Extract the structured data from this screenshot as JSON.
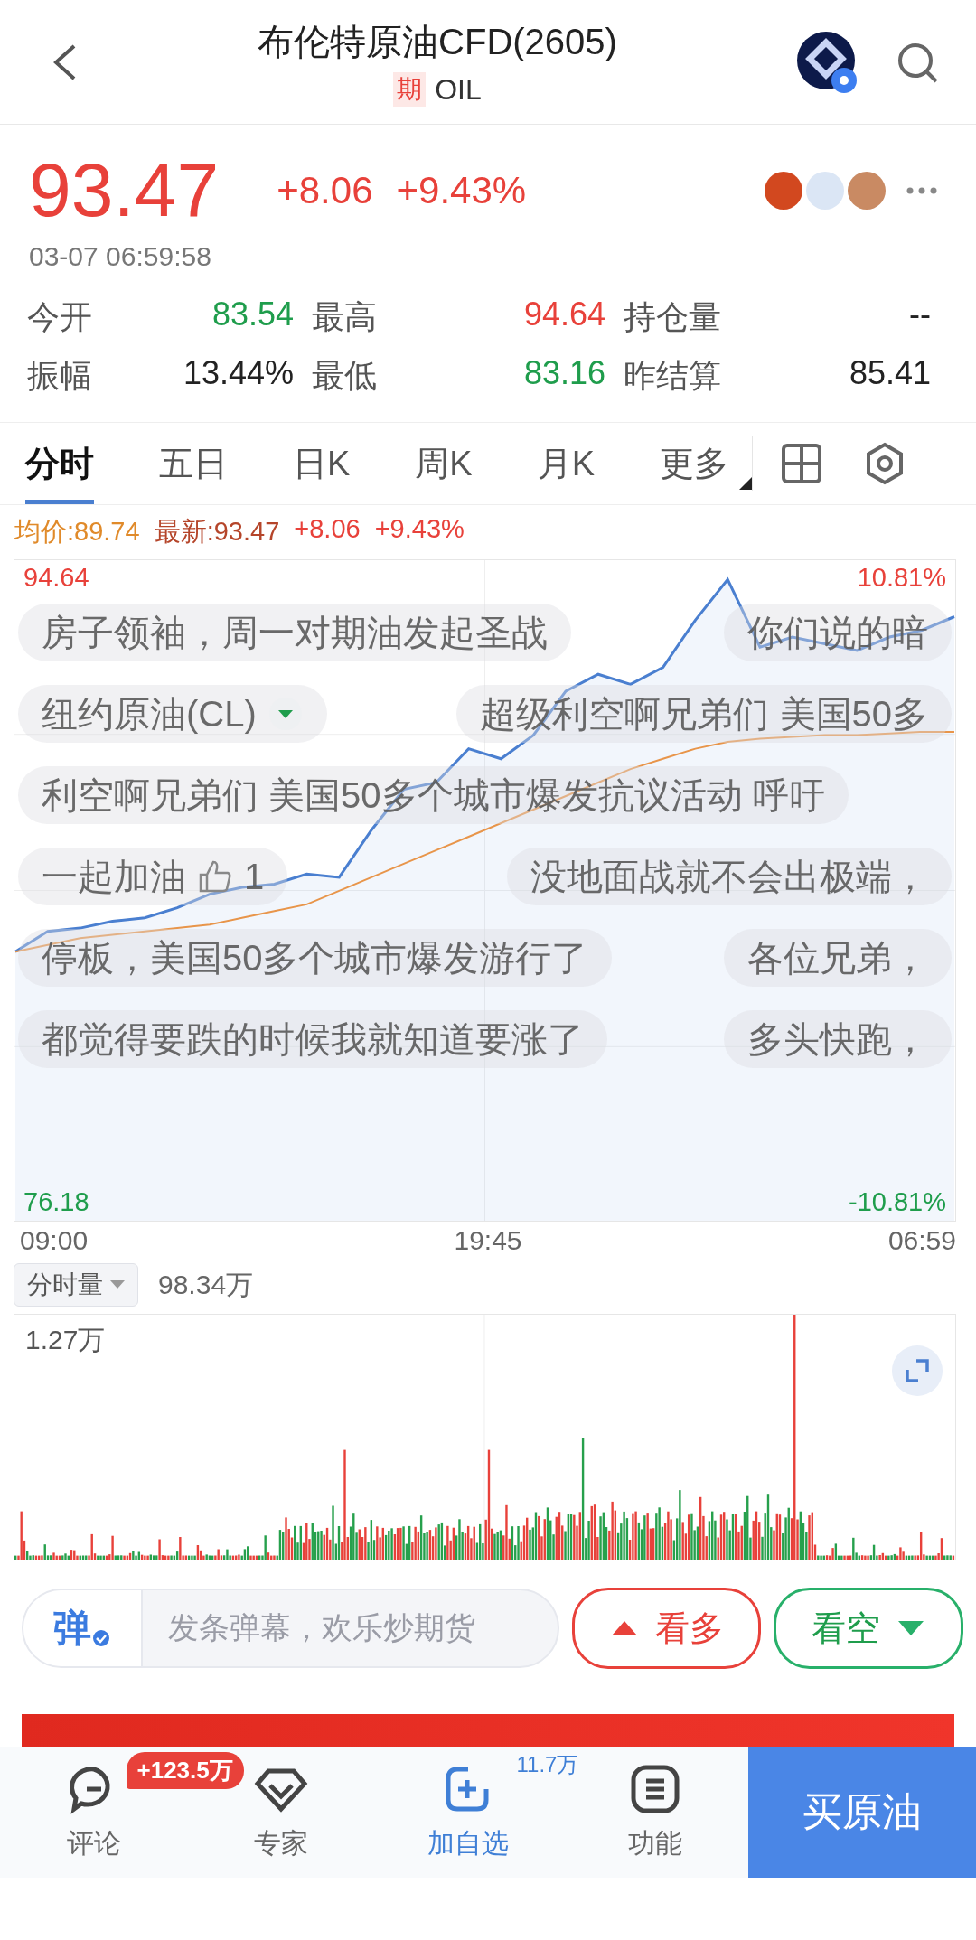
{
  "header": {
    "title": "布伦特原油CFD(2605)",
    "badge": "期",
    "code": "OIL"
  },
  "quote": {
    "price": "93.47",
    "change": "+8.06",
    "change_pct": "+9.43%",
    "time": "03-07 06:59:58"
  },
  "stats": [
    {
      "label": "今开",
      "value": "83.54",
      "color": "#1f9d4c"
    },
    {
      "label": "最高",
      "value": "94.64",
      "color": "#e8413a"
    },
    {
      "label": "持仓量",
      "value": "--",
      "color": "#222222"
    },
    {
      "label": "振幅",
      "value": "13.44%",
      "color": "#222222"
    },
    {
      "label": "最低",
      "value": "83.16",
      "color": "#1f9d4c"
    },
    {
      "label": "昨结算",
      "value": "85.41",
      "color": "#222222"
    }
  ],
  "tabs": [
    {
      "label": "分时",
      "selected": true,
      "kind": "period"
    },
    {
      "label": "五日",
      "selected": false,
      "kind": "period"
    },
    {
      "label": "日K",
      "selected": false,
      "kind": "period"
    },
    {
      "label": "周K",
      "selected": false,
      "kind": "period"
    },
    {
      "label": "月K",
      "selected": false,
      "kind": "period"
    },
    {
      "label": "更多",
      "selected": false,
      "kind": "menu"
    }
  ],
  "legend": [
    {
      "text": "均价:89.74",
      "kind": "average"
    },
    {
      "text": "最新:93.47",
      "kind": "latest"
    },
    {
      "text": "+8.06",
      "kind": "change"
    },
    {
      "text": "+9.43%",
      "kind": "change"
    }
  ],
  "price_chart": {
    "chart_data": {
      "type": "line",
      "ylim": [
        75.65,
        95.17
      ],
      "yticks": [
        {
          "value": 94.64,
          "label": "94.64"
        },
        {
          "value": 76.18,
          "label": "76.18"
        }
      ],
      "series": [
        {
          "color": "#4a7fd0",
          "values": [
            83.6,
            84.2,
            84.3,
            84.5,
            84.6,
            84.9,
            85.3,
            85.5,
            85.6,
            85.9,
            85.8,
            87.2,
            88.4,
            88.6,
            89.6,
            89.3,
            90.0,
            91.3,
            91.8,
            91.5,
            92.0,
            93.4,
            94.6,
            92.6,
            92.9,
            92.7,
            92.5,
            92.9,
            93.1,
            93.5
          ]
        },
        {
          "color": "#e8954a",
          "values": [
            83.6,
            83.8,
            84.0,
            84.1,
            84.2,
            84.3,
            84.4,
            84.6,
            84.8,
            85.0,
            85.4,
            85.8,
            86.2,
            86.6,
            87.0,
            87.4,
            87.8,
            88.2,
            88.6,
            89.0,
            89.3,
            89.6,
            89.8,
            89.9,
            89.95,
            90.0,
            90.0,
            90.05,
            90.1,
            90.1
          ]
        }
      ]
    },
    "right_labels": [
      {
        "text": "10.81%",
        "color": "#e8413a"
      },
      {
        "text": "-10.81%",
        "color": "#1f9d4c"
      }
    ],
    "time_labels": [
      "09:00",
      "19:45",
      "06:59"
    ]
  },
  "danmaku": [
    [
      {
        "text": "房子领袖，周一对期油发起圣战",
        "kind": "text"
      },
      {
        "text": "你们说的暗",
        "kind": "text"
      }
    ],
    [
      {
        "text": "纽约原油(CL)",
        "kind": "dropdown"
      },
      {
        "text": "超级利空啊兄弟们 美国50多",
        "kind": "text"
      }
    ],
    [
      {
        "text": "利空啊兄弟们 美国50多个城市爆发抗议活动 呼吁",
        "kind": "text"
      }
    ],
    [
      {
        "text": "一起加油",
        "kind": "like",
        "count": "1"
      },
      {
        "text": "没地面战就不会出极端，",
        "kind": "text"
      }
    ],
    [
      {
        "text": "停板，美国50多个城市爆发游行了",
        "kind": "text"
      },
      {
        "text": "各位兄弟，",
        "kind": "text"
      }
    ],
    [
      {
        "text": "都觉得要跌的时候我就知道要涨了",
        "kind": "text"
      },
      {
        "text": "多头快跑，",
        "kind": "text"
      }
    ]
  ],
  "volume": {
    "selector": "分时量",
    "total": "98.34万",
    "max_label": "1.27万"
  },
  "comment_bar": {
    "label": "弹",
    "placeholder": "发条弹幕，欢乐炒期货",
    "bull": "看多",
    "bear": "看空"
  },
  "bottom_nav": [
    {
      "label": "评论",
      "kind": "comment",
      "badge": "+123.5万",
      "accent": false
    },
    {
      "label": "专家",
      "kind": "expert",
      "accent": false
    },
    {
      "label": "加自选",
      "kind": "add",
      "count": "11.7万",
      "accent": true
    },
    {
      "label": "功能",
      "kind": "menu",
      "accent": false
    }
  ],
  "buy_button": "买原油"
}
